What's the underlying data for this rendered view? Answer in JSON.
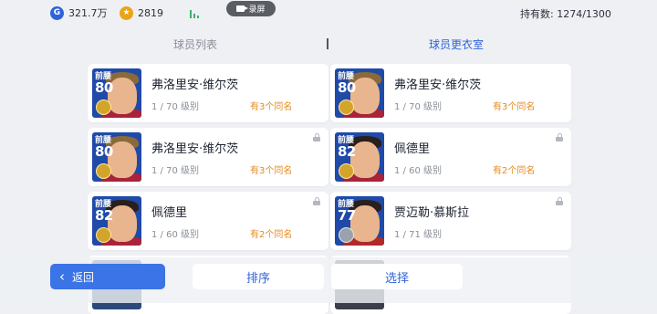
{
  "topbar": {
    "gp_icon": "G",
    "gp_amount": "321.7万",
    "coin_icon": "★",
    "coin_amount": "2819",
    "record_label": "录屏",
    "holding_label": "持有数: 1274/1300"
  },
  "tabs": [
    {
      "label": "球员列表",
      "active": false
    },
    {
      "label": "球员更衣室",
      "active": true
    }
  ],
  "cards": [
    {
      "position": "前腰",
      "rating": "80",
      "name": "弗洛里安·维尔茨",
      "level": "1 / 70 级别",
      "duplicates": "有3个同名",
      "locked": false
    },
    {
      "position": "前腰",
      "rating": "80",
      "name": "弗洛里安·维尔茨",
      "level": "1 / 70 级别",
      "duplicates": "有3个同名",
      "locked": false
    },
    {
      "position": "前腰",
      "rating": "80",
      "name": "弗洛里安·维尔茨",
      "level": "1 / 70 级别",
      "duplicates": "有3个同名",
      "locked": true
    },
    {
      "position": "前腰",
      "rating": "82",
      "name": "佩德里",
      "level": "1 / 60 级别",
      "duplicates": "有2个同名",
      "locked": true
    },
    {
      "position": "前腰",
      "rating": "82",
      "name": "佩德里",
      "level": "1 / 60 级别",
      "duplicates": "有2个同名",
      "locked": true
    },
    {
      "position": "前腰",
      "rating": "77",
      "name": "贾迈勒·慕斯拉",
      "level": "1 / 71 级别",
      "duplicates": "",
      "locked": true
    }
  ],
  "bottom": {
    "back_label": "返回",
    "sort_label": "排序",
    "select_label": "选择"
  },
  "colors": {
    "accent": "#2f63d8",
    "duplicate": "#e58a1f"
  }
}
